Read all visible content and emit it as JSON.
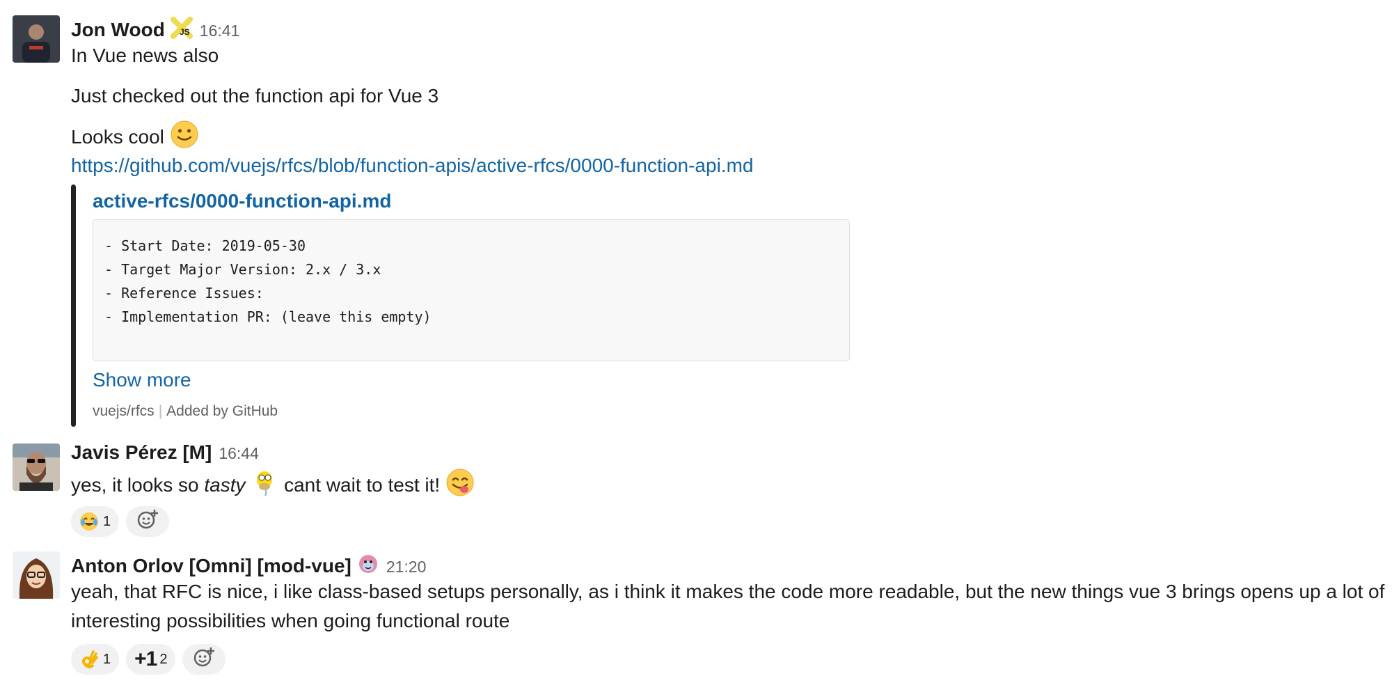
{
  "messages": [
    {
      "author": "Jon Wood",
      "time": "16:41",
      "lines": [
        "In Vue news also",
        "Just checked out the function api for Vue 3",
        "Looks cool"
      ],
      "link": "https://github.com/vuejs/rfcs/blob/function-apis/active-rfcs/0000-function-api.md",
      "attachment": {
        "title": "active-rfcs/0000-function-api.md",
        "code": [
          "- Start Date: 2019-05-30",
          "- Target Major Version: 2.x / 3.x",
          "- Reference Issues:",
          "- Implementation PR: (leave this empty)"
        ],
        "show_more": "Show more",
        "source": "vuejs/rfcs",
        "added_by": "Added by GitHub"
      }
    },
    {
      "author": "Javis Pérez [M]",
      "time": "16:44",
      "text_before": "yes, it looks so ",
      "text_italic": "tasty",
      "text_middle": " cant wait to test it!",
      "reactions": [
        {
          "emoji": "joy-emoji",
          "count": "1"
        }
      ]
    },
    {
      "author": "Anton Orlov [Omni] [mod-vue]",
      "time": "21:20",
      "lines": [
        "yeah, that RFC is nice, i like class-based setups personally, as i think it makes the code more readable, but the new things vue 3 brings opens up a lot of",
        "interesting possibilities when going functional route"
      ],
      "reactions": [
        {
          "emoji": "ok-hand-emoji",
          "count": "1"
        },
        {
          "emoji": "+1",
          "count": "2"
        }
      ]
    }
  ]
}
